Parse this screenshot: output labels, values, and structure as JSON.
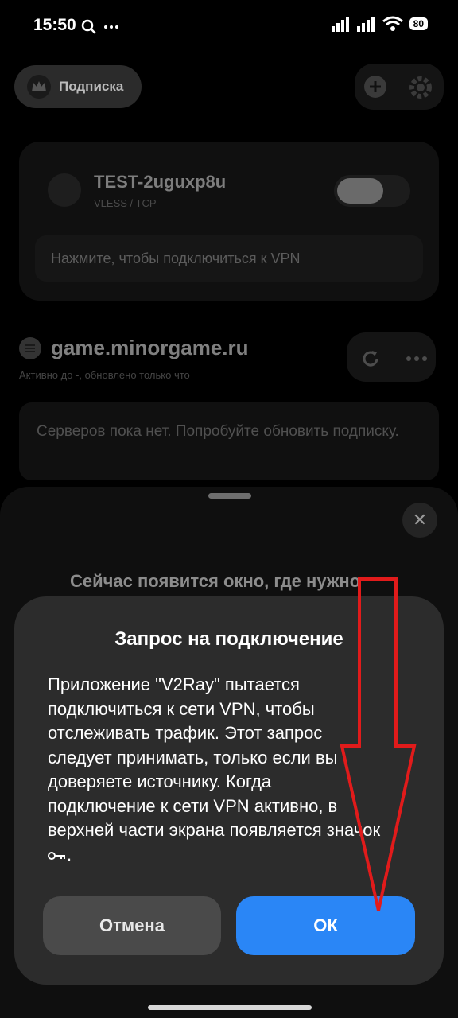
{
  "status_bar": {
    "time": "15:50",
    "battery": "80"
  },
  "header": {
    "subscription_label": "Подписка"
  },
  "server": {
    "name": "TEST-2uguxp8u",
    "protocol": "VLESS / TCP",
    "connect_hint": "Нажмите, чтобы подключиться к VPN"
  },
  "subscription": {
    "title": "game.minorgame.ru",
    "meta": "Активно до -, обновлено только что",
    "empty_message": "Серверов пока нет. Попробуйте обновить подписку."
  },
  "sheet": {
    "text": "Сейчас появится окно, где нужно"
  },
  "dialog": {
    "title": "Запрос на подключение",
    "body": "Приложение \"V2Ray\" пытается подключиться к сети VPN, чтобы отслеживать трафик. Этот запрос следует принимать, только если вы доверяете источнику. Когда подключение к сети VPN активно, в верхней части экрана появляется значок",
    "cancel_label": "Отмена",
    "ok_label": "ОК"
  },
  "colors": {
    "accent": "#2a86f6",
    "annotation": "#e11b1b"
  }
}
